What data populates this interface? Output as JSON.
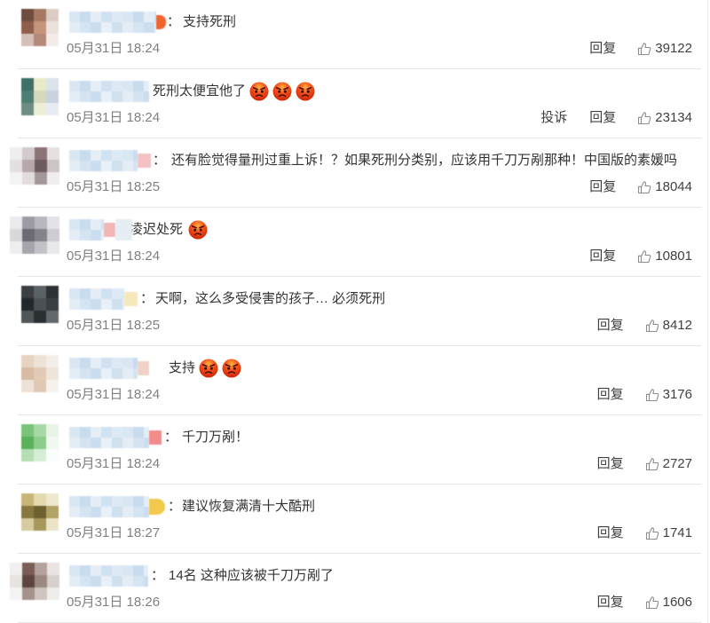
{
  "icons": {
    "like": "thumbs-up-icon",
    "emoji": "angry-face"
  },
  "comments": [
    {
      "sep": "：",
      "text": "支持死刑",
      "time": "05月31日 18:24",
      "reply": "回复",
      "likes": 39122
    },
    {
      "text": "死刑太便宜他了",
      "emojis": [
        "angry-face",
        "angry-face",
        "angry-face"
      ],
      "time": "05月31日 18:24",
      "report": "投诉",
      "reply": "回复",
      "likes": 23134
    },
    {
      "sep": "：",
      "text": "还有脸觉得量刑过重上诉！？如果死刑分类别，应该用千刀万剐那种！中国版的素媛吗",
      "time": "05月31日 18:25",
      "reply": "回复",
      "likes": 18044
    },
    {
      "text": "凌迟处死",
      "emojis": [
        "angry-face"
      ],
      "time": "05月31日 18:24",
      "reply": "回复",
      "likes": 10801
    },
    {
      "sep": "：",
      "text": "天啊，这么多受侵害的孩子… 必须死刑",
      "time": "05月31日 18:25",
      "reply": "回复",
      "likes": 8412
    },
    {
      "text": "支持",
      "emojis": [
        "angry-face",
        "angry-face"
      ],
      "time": "05月31日 18:24",
      "reply": "回复",
      "likes": 3176
    },
    {
      "sep": "：",
      "text": "千刀万剐！",
      "time": "05月31日 18:24",
      "reply": "回复",
      "likes": 2727
    },
    {
      "sep": "：",
      "text": "建议恢复满清十大酷刑",
      "time": "05月31日 18:27",
      "reply": "回复",
      "likes": 1741
    },
    {
      "sep": "：",
      "text": "14名 这种应该被千刀万剐了",
      "time": "05月31日 18:26",
      "reply": "回复",
      "likes": 1606
    }
  ]
}
